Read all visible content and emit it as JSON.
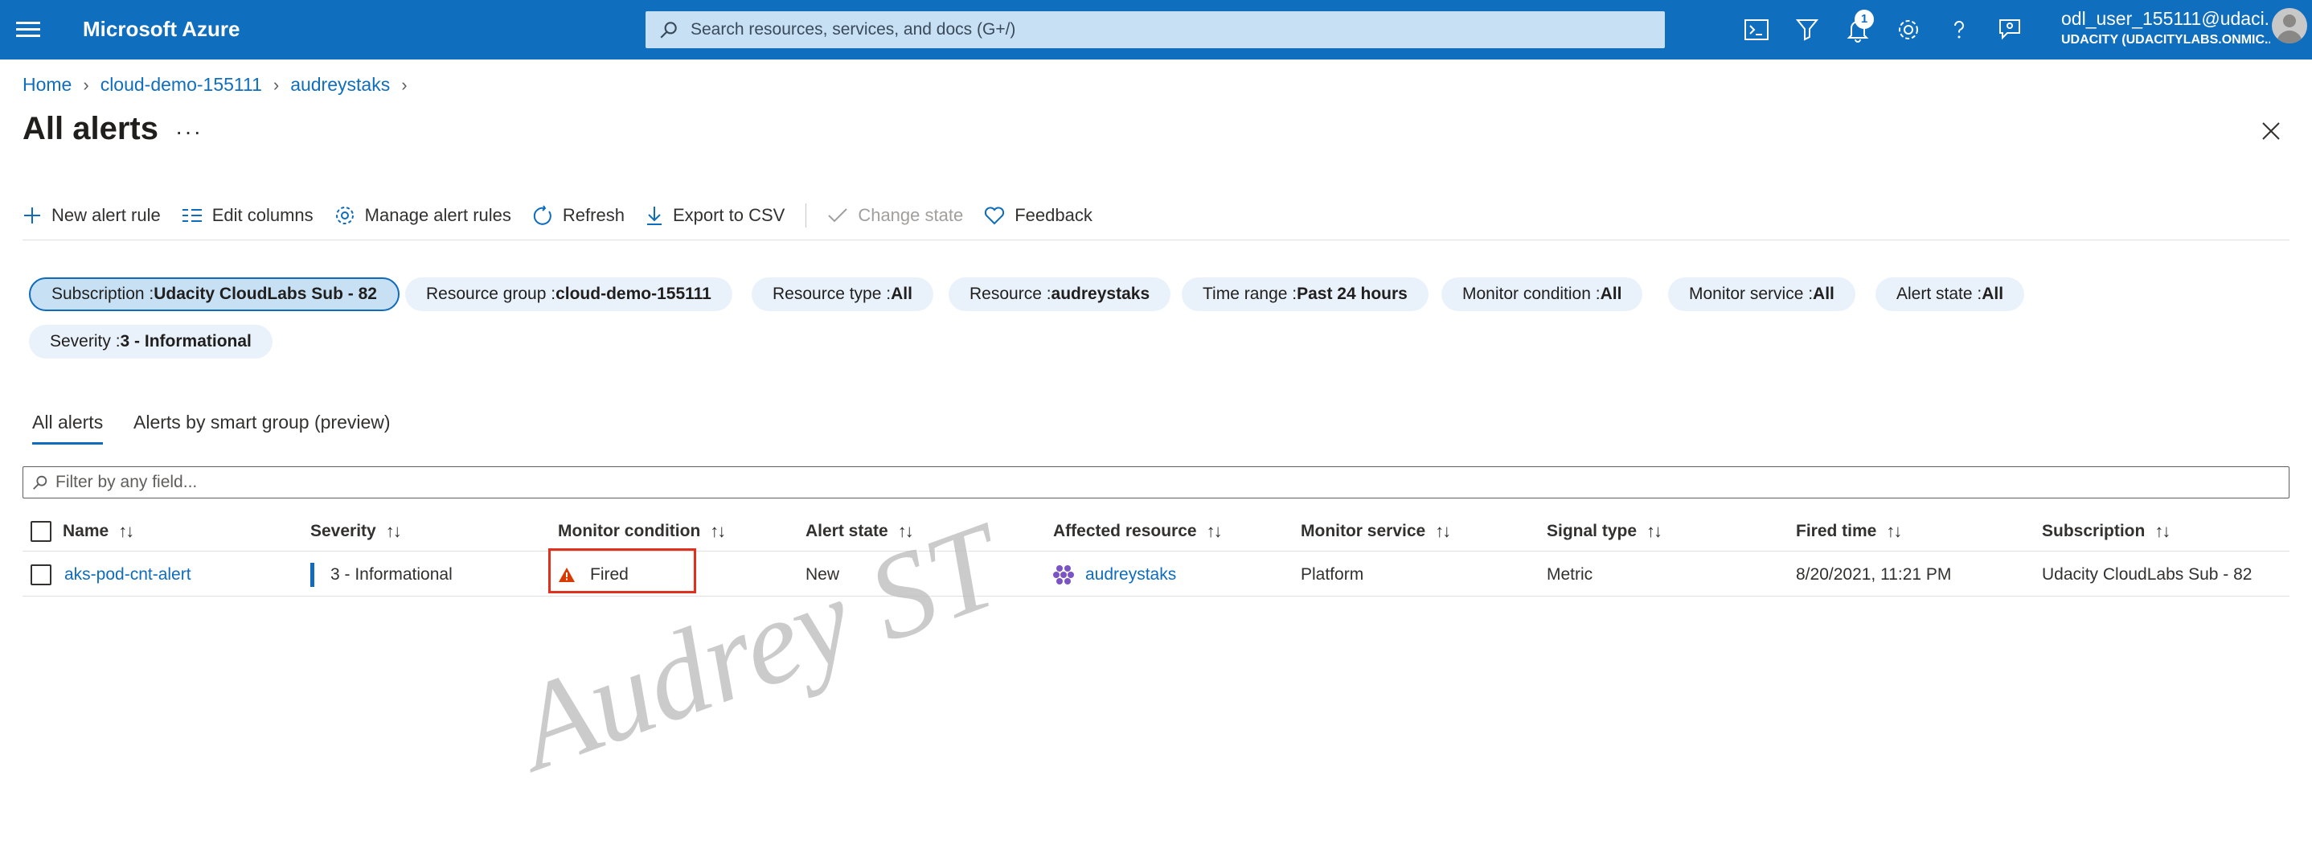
{
  "header": {
    "brand": "Microsoft Azure",
    "search_placeholder": "Search resources, services, and docs (G+/)",
    "notification_count": "1",
    "user_name": "odl_user_155111@udaci...",
    "user_tenant": "UDACITY (UDACITYLABS.ONMIC..."
  },
  "breadcrumb": [
    "Home",
    "cloud-demo-155111",
    "audreystaks"
  ],
  "page": {
    "title": "All alerts",
    "more": "···"
  },
  "toolbar": {
    "new_alert_rule": "New alert rule",
    "edit_columns": "Edit columns",
    "manage_alert_rules": "Manage alert rules",
    "refresh": "Refresh",
    "export_csv": "Export to CSV",
    "change_state": "Change state",
    "feedback": "Feedback"
  },
  "filters": [
    {
      "label": "Subscription : ",
      "value": "Udacity CloudLabs Sub - 82"
    },
    {
      "label": "Resource group : ",
      "value": "cloud-demo-155111"
    },
    {
      "label": "Resource type : ",
      "value": "All"
    },
    {
      "label": "Resource : ",
      "value": "audreystaks"
    },
    {
      "label": "Time range : ",
      "value": "Past 24 hours"
    },
    {
      "label": "Monitor condition : ",
      "value": "All"
    },
    {
      "label": "Monitor service : ",
      "value": "All"
    },
    {
      "label": "Alert state : ",
      "value": "All"
    },
    {
      "label": "Severity : ",
      "value": "3 - Informational"
    }
  ],
  "tabs": [
    "All alerts",
    "Alerts by smart group (preview)"
  ],
  "filter_placeholder": "Filter by any field...",
  "table": {
    "sort_glyph": "↑↓",
    "columns": [
      "Name",
      "Severity",
      "Monitor condition",
      "Alert state",
      "Affected resource",
      "Monitor service",
      "Signal type",
      "Fired time",
      "Subscription"
    ],
    "rows": [
      {
        "name": "aks-pod-cnt-alert",
        "severity": "3 - Informational",
        "monitor_condition": "Fired",
        "alert_state": "New",
        "affected_resource": "audreystaks",
        "monitor_service": "Platform",
        "signal_type": "Metric",
        "fired_time": "8/20/2021, 11:21 PM",
        "subscription": "Udacity CloudLabs Sub - 82"
      }
    ]
  },
  "watermark": "Audrey ST",
  "colors": {
    "header_bg": "#106ebe",
    "accent": "#0f6cbd",
    "highlight_box": "#e0301e",
    "warning": "#d83b01"
  }
}
